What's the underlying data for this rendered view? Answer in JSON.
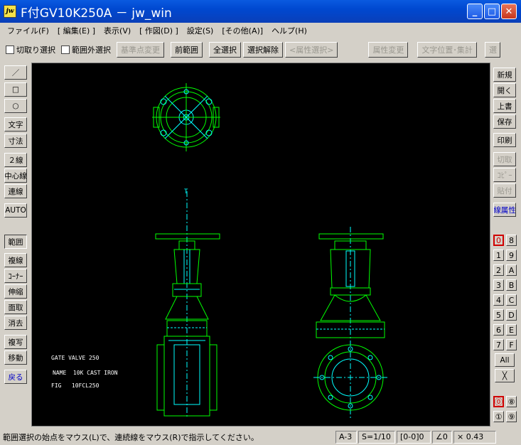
{
  "window": {
    "title": "F付GV10K250A － jw_win",
    "app_icon": "jw",
    "colors": {
      "titlebar": "#0a4fd8",
      "canvas": "#000000",
      "line_green": "#00ff00",
      "line_cyan": "#00ffff",
      "accent_red": "#d00000"
    }
  },
  "menu": [
    "ファイル(F)",
    "[ 編集(E) ]",
    "表示(V)",
    "[ 作図(D) ]",
    "設定(S)",
    "[その他(A)]",
    "ヘルプ(H)"
  ],
  "toolbar": {
    "check_cut": "切取り選択",
    "check_outside": "範囲外選択",
    "base_point": "基準点変更",
    "prev_range": "前範囲",
    "select_all": "全選択",
    "deselect": "選択解除",
    "attr_select": "<属性選択>",
    "attr_change": "属性変更",
    "text_pos": "文字位置･集計",
    "overflow": "選"
  },
  "left_tools": [
    "／",
    "□",
    "○",
    "文字",
    "寸法",
    "２線",
    "中心線",
    "連線",
    "AUTO",
    "範囲",
    "複線",
    "ｺｰﾅｰ",
    "伸縮",
    "面取",
    "消去",
    "複写",
    "移動",
    "戻る"
  ],
  "right_tools": [
    "新規",
    "開く",
    "上書",
    "保存",
    "印刷",
    "切取",
    "ｺﾋﾟｰ",
    "貼付",
    "線属性"
  ],
  "layers": {
    "col1": [
      "0",
      "1",
      "2",
      "3",
      "4",
      "5",
      "6",
      "7"
    ],
    "col2": [
      "8",
      "9",
      "A",
      "B",
      "C",
      "D",
      "E",
      "F"
    ],
    "all": "All",
    "x": "╳",
    "groups": [
      "⓪",
      "⑧",
      "①",
      "⑨"
    ]
  },
  "drawing": {
    "label1": "GATE VALVE 250",
    "label2": "NAME  10K CAST IRON",
    "label3": "FIG   10FCL250",
    "marker": "T"
  },
  "status": {
    "message": "範囲選択の始点をマウス(L)で、連続線をマウス(R)で指示してください。",
    "paper": "A-3",
    "scale": "S=1/10",
    "layer": "[0-0]0",
    "angle": "∠0",
    "zoom": "× 0.43"
  }
}
